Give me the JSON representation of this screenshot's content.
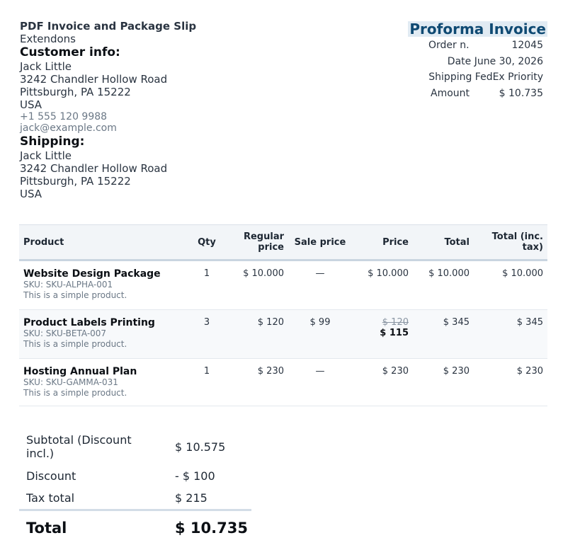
{
  "doc": {
    "header_title": "PDF Invoice and Package Slip",
    "company": "Extendons",
    "invoice_title": "Proforma Invoice"
  },
  "customer": {
    "title": "Customer info:",
    "name": "Jack Little",
    "street": "3242 Chandler Hollow Road",
    "city": "Pittsburgh, PA 15222",
    "country": "USA",
    "phone": "+1 555 120 9988",
    "email": "jack@example.com"
  },
  "shipping": {
    "title": "Shipping:",
    "name": "Jack Little",
    "street": "3242 Chandler Hollow Road",
    "city": "Pittsburgh, PA 15222",
    "country": "USA"
  },
  "meta": {
    "order_label": "Order n.",
    "order_value": "12045",
    "date_text": "Date June 30, 2026",
    "shipping_text": "Shipping FedEx Priority",
    "amount_label": "Amount",
    "amount_value": "$ 10.735"
  },
  "table": {
    "headers": {
      "product": "Product",
      "qty": "Qty",
      "regular_1": "Regular",
      "regular_2": "price",
      "sale": "Sale price",
      "price": "Price",
      "total": "Total",
      "total_tax_1": "Total (inc.",
      "total_tax_2": "tax)"
    },
    "rows": [
      {
        "name": "Website Design Package",
        "sku": "SKU: SKU-ALPHA-001",
        "desc": "This is a simple product.",
        "qty": "1",
        "regular": "$ 10.000",
        "sale": "—",
        "price": "$ 10.000",
        "total": "$ 10.000",
        "total_tax": "$ 10.000"
      },
      {
        "name": "Product Labels Printing",
        "sku": "SKU: SKU-BETA-007",
        "desc": "This is a simple product.",
        "qty": "3",
        "regular": "$ 120",
        "sale": "$ 99",
        "price_old": "$ 120",
        "price": "$ 115",
        "total": "$ 345",
        "total_tax": "$ 345"
      },
      {
        "name": "Hosting Annual Plan",
        "sku": "SKU: SKU-GAMMA-031",
        "desc": "This is a simple product.",
        "qty": "1",
        "regular": "$ 230",
        "sale": "—",
        "price": "$ 230",
        "total": "$ 230",
        "total_tax": "$ 230"
      }
    ]
  },
  "totals": {
    "subtotal_label_1": "Subtotal (Discount",
    "subtotal_label_2": "incl.)",
    "subtotal_value": "$ 10.575",
    "discount_label": "Discount",
    "discount_value": "- $ 100",
    "tax_label": "Tax total",
    "tax_value": "$ 215",
    "total_label": "Total",
    "total_value": "$ 10.735"
  }
}
